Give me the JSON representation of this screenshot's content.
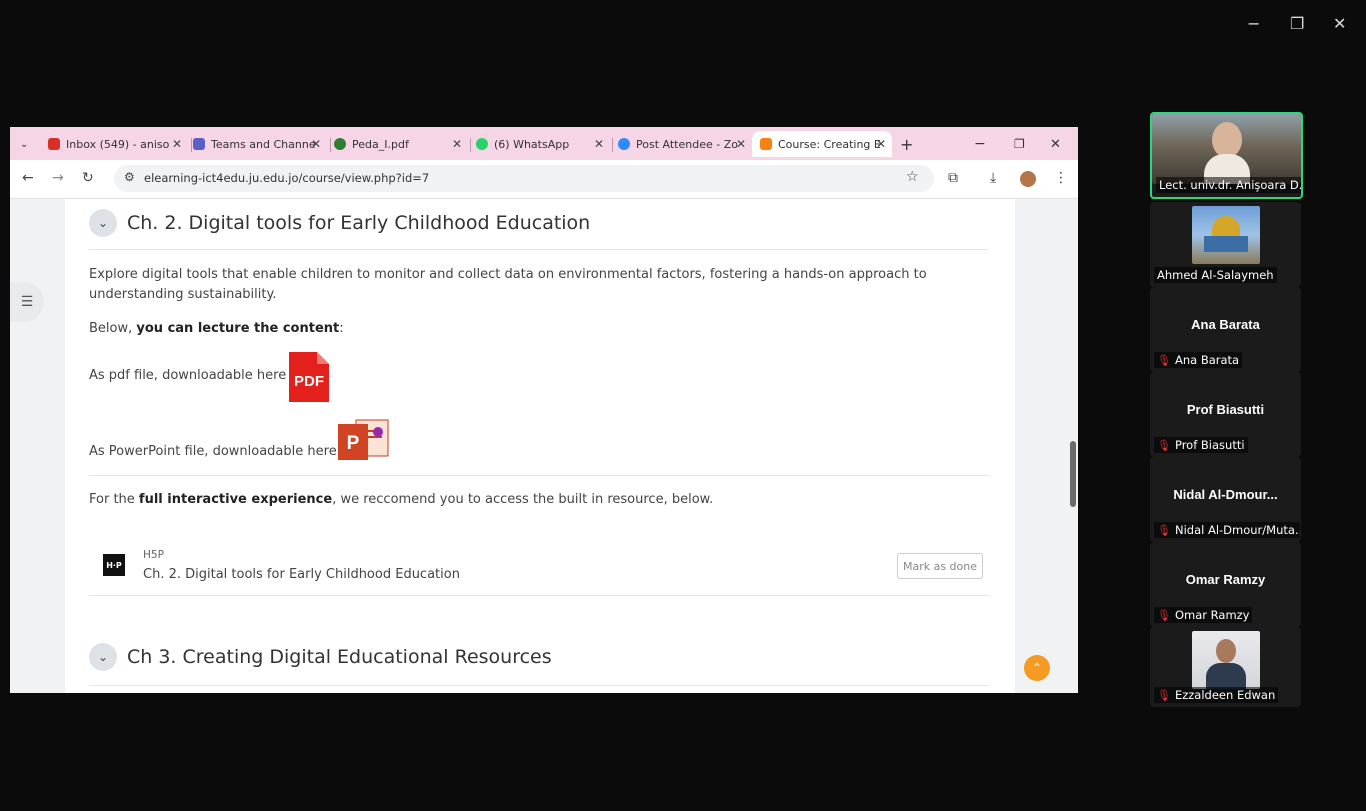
{
  "window_controls": {
    "minimize": "−",
    "restore": "❐",
    "close": "✕"
  },
  "browser": {
    "tabs": [
      {
        "label": "Inbox (549) - aniso",
        "favicon_color": "#d93025"
      },
      {
        "label": "Teams and Channe",
        "favicon_color": "#5b5fc7"
      },
      {
        "label": "Peda_I.pdf",
        "favicon_color": "#2e7d32"
      },
      {
        "label": "(6) WhatsApp",
        "favicon_color": "#25d366"
      },
      {
        "label": "Post Attendee - Zo",
        "favicon_color": "#2d8cff"
      },
      {
        "label": "Course: Creating E",
        "favicon_color": "#f98012",
        "active": true
      }
    ],
    "new_tab": "+",
    "tab_close": "✕",
    "url": "elearning-ict4edu.ju.edu.jo/course/view.php?id=7"
  },
  "course": {
    "section2_title": "Ch. 2. Digital tools for Early Childhood Education",
    "intro": "Explore digital tools that enable children to monitor and collect data on environmental factors, fostering a hands-on approach to understanding sustainability.",
    "below_prefix": "Below, ",
    "below_bold": "you can lecture the content",
    "below_suffix": ":",
    "pdf_text": "As pdf file, downloadable here",
    "pdf_icon_label": "PDF",
    "ppt_text": "As PowerPoint file, downloadable here.",
    "ppt_icon_label": "P",
    "interactive_prefix": "For the ",
    "interactive_bold": "full interactive experience",
    "interactive_suffix": ", we reccomend you to access the built in resource, below.",
    "activity_type": "H5P",
    "activity_name": "Ch. 2. Digital tools for Early Childhood Education",
    "mark_as_done": "Mark as done",
    "section3_title": "Ch 3. Creating Digital Educational Resources"
  },
  "participants": [
    {
      "display_name": "Lect. univ.dr. Anişoara D...",
      "video": true,
      "speaking": true
    },
    {
      "display_name": "Ahmed Al-Salaymeh",
      "video": true
    },
    {
      "big_name": "Ana Barata",
      "display_name": "Ana Barata",
      "muted": true
    },
    {
      "big_name": "Prof Biasutti",
      "display_name": "Prof Biasutti",
      "muted": true
    },
    {
      "big_name": "Nidal  Al-Dmour...",
      "display_name": "Nidal Al-Dmour/Muta...",
      "muted": true
    },
    {
      "big_name": "Omar Ramzy",
      "display_name": "Omar Ramzy",
      "muted": true
    },
    {
      "display_name": "Ezzaldeen Edwan",
      "video": true,
      "muted": true
    }
  ],
  "colors": {
    "tab_bar": "#f5d5e6",
    "speaking_border": "#2bd97c",
    "scroll_top": "#f59a23"
  }
}
